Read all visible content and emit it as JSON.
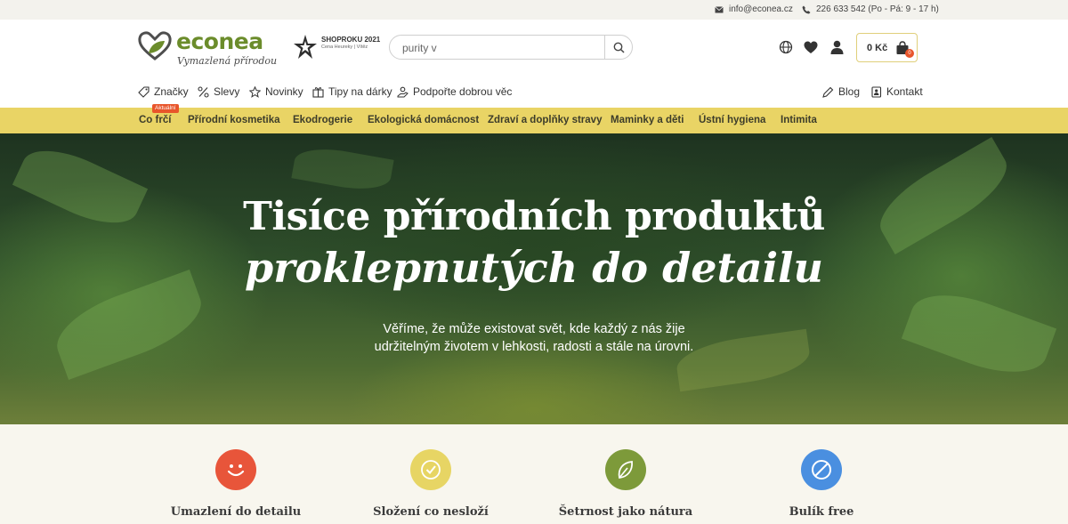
{
  "topbar": {
    "email": "info@econea.cz",
    "phone": "226 633 542 (Po - Pá: 9 - 17 h)"
  },
  "header": {
    "logo_text": "econea",
    "logo_tagline": "Vymazlená přírodou",
    "award_title": "SHOPROKU 2021",
    "award_sub": "Cena Heureky | Vítěz",
    "search": {
      "value": "purity v",
      "placeholder": ""
    },
    "cart_price": "0 Kč",
    "cart_count": "0"
  },
  "subnav_left": [
    {
      "label": "Značky",
      "icon": "tag-icon"
    },
    {
      "label": "Slevy",
      "icon": "percent-icon"
    },
    {
      "label": "Novinky",
      "icon": "star-icon"
    },
    {
      "label": "Tipy na dárky",
      "icon": "gift-icon"
    },
    {
      "label": "Podpořte dobrou věc",
      "icon": "charity-icon"
    }
  ],
  "subnav_right": [
    {
      "label": "Blog",
      "icon": "pencil-icon"
    },
    {
      "label": "Kontakt",
      "icon": "contact-icon"
    }
  ],
  "categories": {
    "badge": "Aktuální",
    "items": [
      "Co frčí",
      "Přírodní kosmetika",
      "Ekodrogerie",
      "Ekologická domácnost",
      "Zdraví a doplňky stravy",
      "Maminky a děti",
      "Ústní hygiena",
      "Intimita"
    ]
  },
  "hero": {
    "title": "Tisíce přírodních produktů",
    "subtitle": "proklepnutých do detailu",
    "text_line1": "Věříme, že může existovat svět, kde každý z nás žije",
    "text_line2": "udržitelným životem v lehkosti, radosti a stále na úrovni."
  },
  "features": [
    {
      "title": "Umazlení do detailu",
      "icon": "smile-icon",
      "color": "#e8553a"
    },
    {
      "title": "Složení co nesloží",
      "icon": "check-icon",
      "color": "#e7d564"
    },
    {
      "title": "Šetrnost jako nátura",
      "icon": "leaf-icon",
      "color": "#7d9a3a"
    },
    {
      "title": "Bulík free",
      "icon": "no-icon",
      "color": "#4a8fe0"
    }
  ],
  "colors": {
    "brand_green": "#6b8c2b",
    "category_bar": "#e9d465",
    "accent_red": "#e8552b"
  }
}
